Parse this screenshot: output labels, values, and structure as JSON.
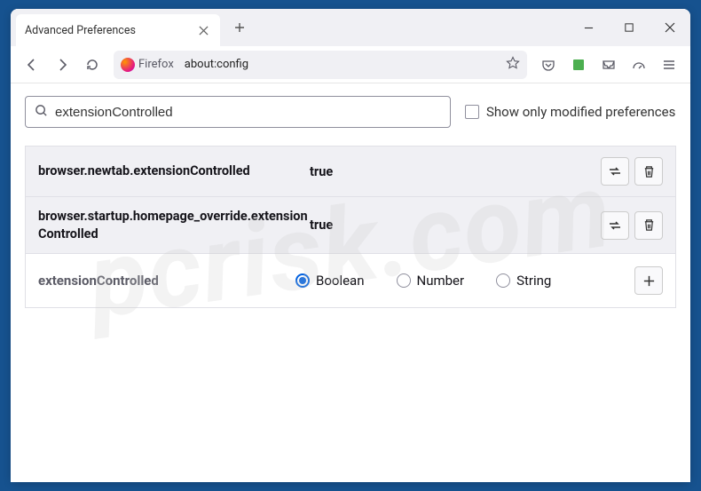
{
  "tab": {
    "title": "Advanced Preferences"
  },
  "urlbar": {
    "label": "Firefox",
    "url": "about:config"
  },
  "search": {
    "value": "extensionControlled",
    "modified_label": "Show only modified preferences"
  },
  "prefs": [
    {
      "name": "browser.newtab.extensionControlled",
      "value": "true"
    },
    {
      "name": "browser.startup.homepage_override.extensionControlled",
      "value": "true"
    }
  ],
  "new_pref": {
    "name": "extensionControlled",
    "types": {
      "boolean": "Boolean",
      "number": "Number",
      "string": "String"
    },
    "selected": "boolean"
  },
  "watermark": "pcrisk.com"
}
